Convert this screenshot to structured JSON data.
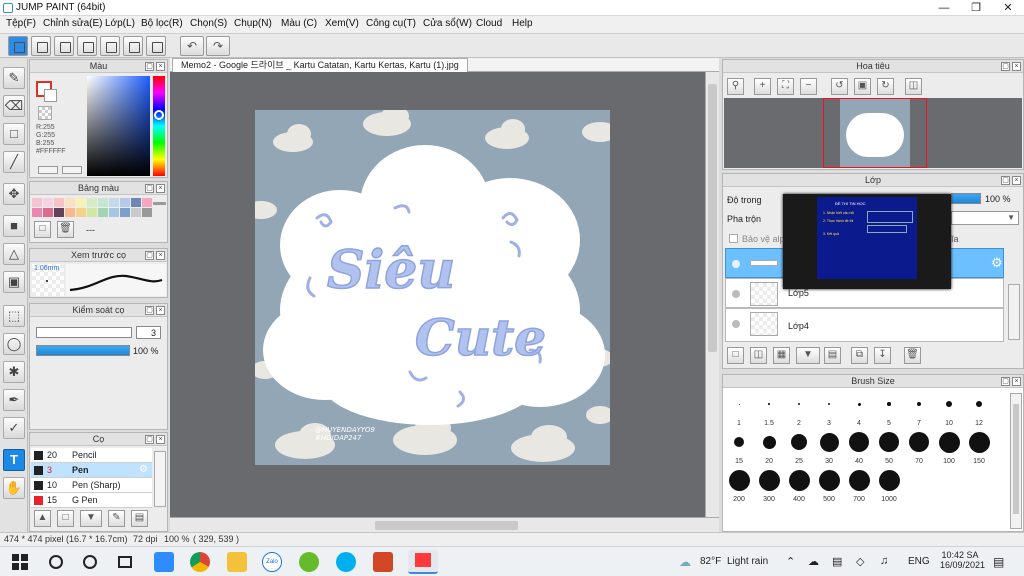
{
  "window": {
    "title": "JUMP PAINT (64bit)",
    "minimize_icon": "minimize-icon",
    "maximize_icon": "restore-icon",
    "close_icon": "close-icon"
  },
  "menu": [
    "Tệp(F)",
    "Chỉnh sửa(E)",
    "Lớp(L)",
    "Bộ lọc(R)",
    "Chọn(S)",
    "Chụp(N)",
    "Màu (C)",
    "Xem(V)",
    "Công cụ(T)",
    "Cửa sổ(W)",
    "Cloud",
    "Help"
  ],
  "color_panel": {
    "title": "Màu",
    "r": "R:255",
    "g": "G:255",
    "b": "B:255",
    "hex": "#FFFFFF",
    "hue_color": "#1f5fff"
  },
  "swatch_panel": {
    "title": "Bảng màu",
    "name": "---",
    "colors": [
      "#f6c3d3",
      "#f7d2e2",
      "#f7c3c7",
      "#fbe1c0",
      "#f8f2b8",
      "#d6ecc4",
      "#c7e6d2",
      "#c6d9ec",
      "#b8c9ec",
      "#6f86b8",
      "#f4a7bf",
      "#e887b1",
      "#dc6b8e",
      "#61435b",
      "#f8b990",
      "#f2d48c",
      "#d3e7a5",
      "#a3d2b4",
      "#a4c6e0",
      "#7aa0cb",
      "#cacaca",
      "#999999"
    ]
  },
  "brush_preview": {
    "title": "Xem trước cọ",
    "size": "1.06mm"
  },
  "brush_control": {
    "title": "Kiểm soát cọ",
    "size_value": "3",
    "opacity_value": "100 %"
  },
  "brush_list": {
    "title": "Cọ",
    "items": [
      {
        "size": "20",
        "name": "Pencil",
        "color": "#222222"
      },
      {
        "size": "3",
        "name": "Pen",
        "color": "#222222"
      },
      {
        "size": "10",
        "name": "Pen (Sharp)",
        "color": "#222222"
      },
      {
        "size": "15",
        "name": "G Pen",
        "color": "#e8242a"
      }
    ]
  },
  "document": {
    "tab_title": "Memo2 - Google 드라이브 _ Kartu Catatan, Kartu Kertas, Kartu (1).jpg",
    "art_title_line1": "Siêu",
    "art_title_line2": "Cute",
    "watermark_line1": "@HUYENDAYYO9",
    "watermark_line2": "#HOIDAP247"
  },
  "navigator": {
    "title": "Hoa tiêu"
  },
  "layer_panel": {
    "title": "Lớp",
    "opacity_label": "Độ trong",
    "opacity_value": "100 %",
    "blend_label": "Pha trộn",
    "protect_label": "Bảo vệ alph",
    "clip_label": "ĩa",
    "layers": [
      "",
      "Lớp5",
      "Lớp4"
    ]
  },
  "brush_size": {
    "title": "Brush Size",
    "sizes": [
      "1",
      "1.5",
      "2",
      "3",
      "4",
      "5",
      "7",
      "10",
      "12",
      "15",
      "20",
      "25",
      "30",
      "40",
      "50",
      "70",
      "100",
      "150",
      "200",
      "300",
      "400",
      "500",
      "700",
      "1000"
    ]
  },
  "statusbar": {
    "size": "474 * 474 pixel",
    "physical": "(16.7 * 16.7cm)",
    "dpi": "72 dpi",
    "zoom": "100 %",
    "coords": "( 329, 539 )"
  },
  "taskbar": {
    "weather": "82°F",
    "weather_desc": "Light rain",
    "lang": "ENG",
    "time": "10:42 SA",
    "date": "16/09/2021",
    "zalo_label": "Zalo"
  },
  "overlay_slide": {
    "title": "ĐỀ THI TIN HỌC",
    "line1": "1. Nhận biết câu hỏi",
    "line2": "2. Thực hành đề thi",
    "line3": "3. Kết quả"
  }
}
